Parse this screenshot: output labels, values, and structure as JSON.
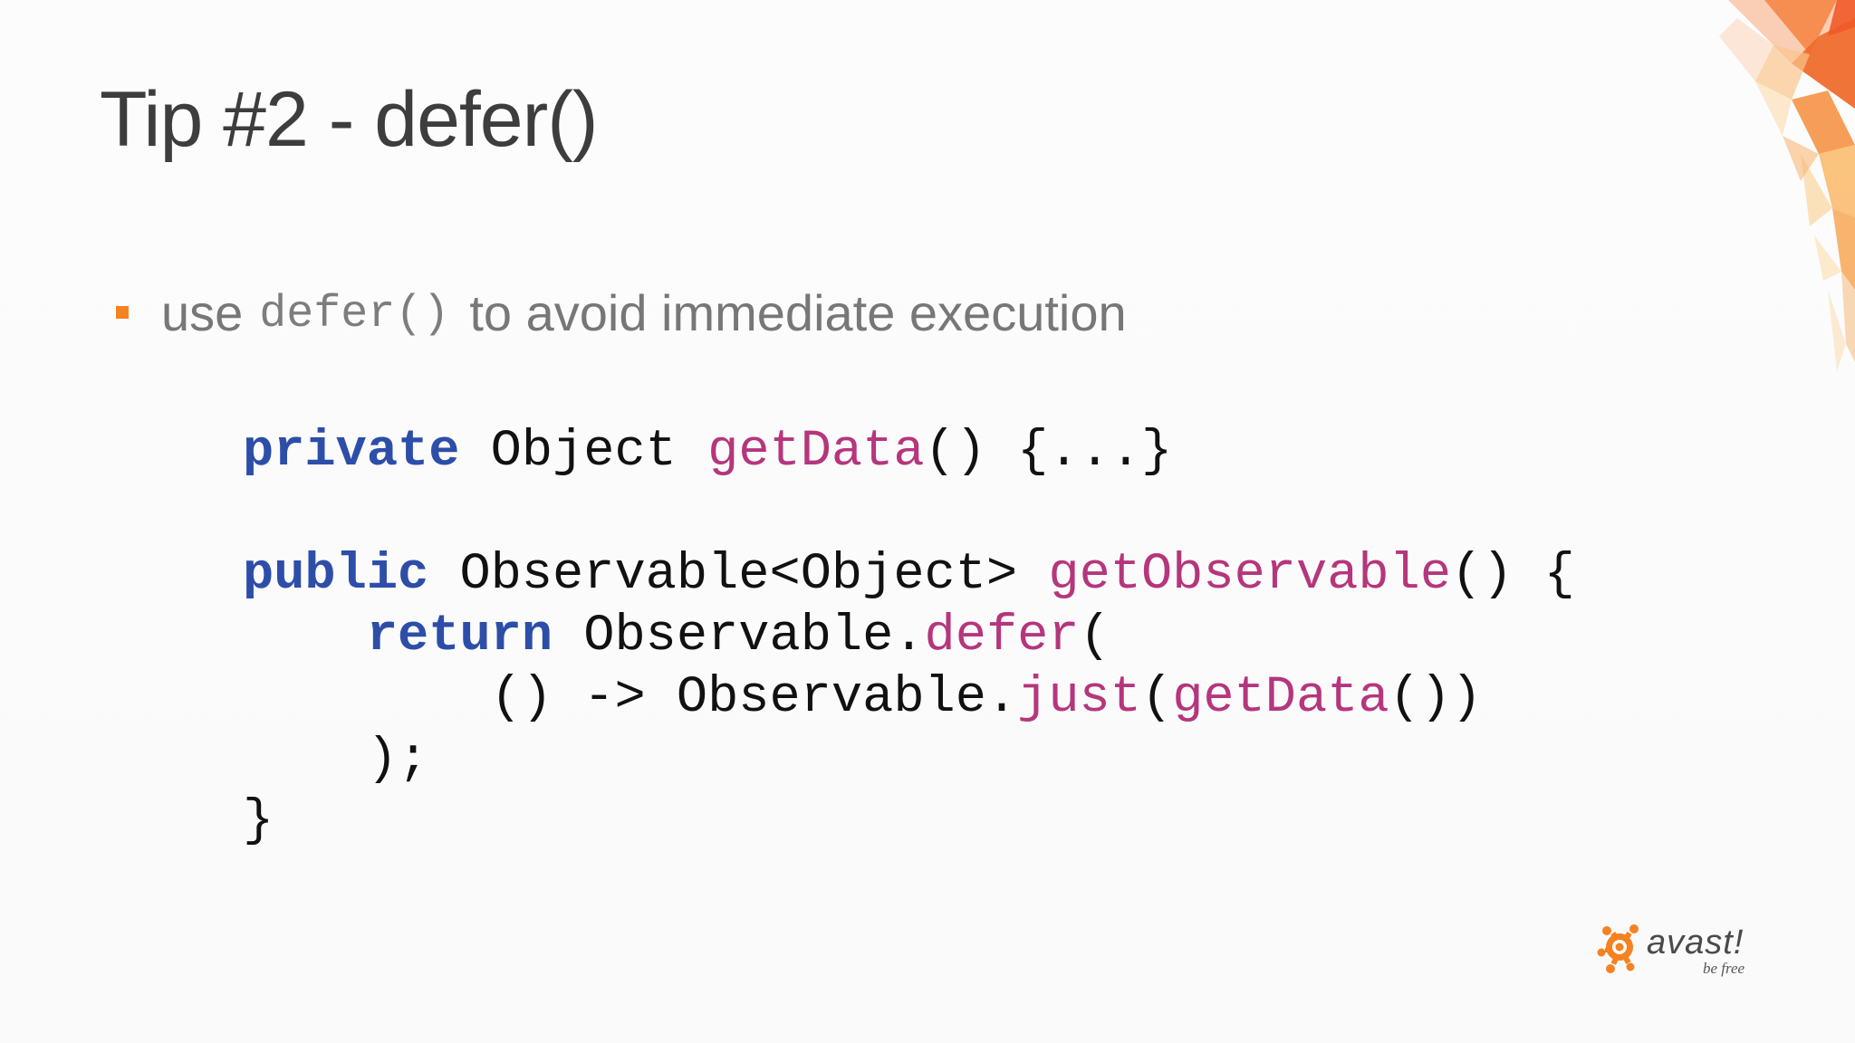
{
  "slide": {
    "title": "Tip #2 - defer()",
    "bullet": {
      "before": "use",
      "code": "defer()",
      "after": "to avoid immediate execution"
    },
    "code_lines": [
      [
        {
          "t": "private",
          "c": "kw"
        },
        {
          "t": " Object ",
          "c": "plain"
        },
        {
          "t": "getData",
          "c": "fn"
        },
        {
          "t": "() {...}",
          "c": "plain"
        }
      ],
      [],
      [
        {
          "t": "public",
          "c": "kw"
        },
        {
          "t": " Observable<Object> ",
          "c": "plain"
        },
        {
          "t": "getObservable",
          "c": "fn"
        },
        {
          "t": "() {",
          "c": "plain"
        }
      ],
      [
        {
          "t": "    ",
          "c": "plain"
        },
        {
          "t": "return",
          "c": "kw"
        },
        {
          "t": " Observable.",
          "c": "plain"
        },
        {
          "t": "defer",
          "c": "fn"
        },
        {
          "t": "(",
          "c": "plain"
        }
      ],
      [
        {
          "t": "        () -> Observable.",
          "c": "plain"
        },
        {
          "t": "just",
          "c": "fn"
        },
        {
          "t": "(",
          "c": "plain"
        },
        {
          "t": "getData",
          "c": "fn"
        },
        {
          "t": "())",
          "c": "plain"
        }
      ],
      [
        {
          "t": "    );",
          "c": "plain"
        }
      ],
      [
        {
          "t": "}",
          "c": "plain"
        }
      ]
    ]
  },
  "logo": {
    "wordmark": "avast!",
    "tagline": "be free"
  },
  "colors": {
    "accent": "#f58220",
    "keyword": "#2d4ea8",
    "method": "#b5367d",
    "title": "#3d3d3d",
    "body_text": "#777777"
  },
  "icons": [
    "bullet-square-icon",
    "avast-orb-icon",
    "corner-polygon-art"
  ]
}
